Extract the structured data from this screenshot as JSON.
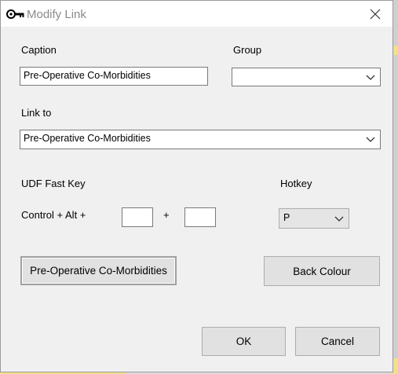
{
  "window": {
    "title": "Modify Link"
  },
  "caption": {
    "label": "Caption",
    "value": "Pre-Operative Co-Morbidities"
  },
  "group": {
    "label": "Group",
    "value": ""
  },
  "link_to": {
    "label": "Link to",
    "value": "Pre-Operative Co-Morbidities"
  },
  "udf": {
    "label": "UDF Fast Key",
    "modifier_text": "Control + Alt +",
    "plus_text": "+",
    "key1": "",
    "key2": ""
  },
  "hotkey": {
    "label": "Hotkey",
    "value": "P"
  },
  "buttons": {
    "font_button": "Pre-Operative Co-Morbidities",
    "back_colour": "Back Colour",
    "ok": "OK",
    "cancel": "Cancel"
  },
  "icons": {
    "window_icon": "key-icon",
    "close": "close-icon",
    "dropdown": "chevron-down-icon"
  }
}
